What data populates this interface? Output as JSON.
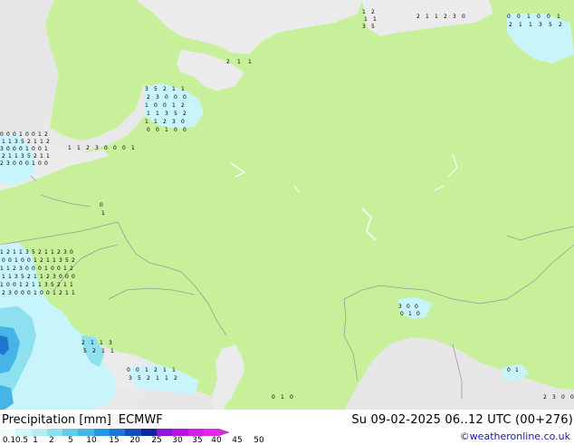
{
  "map": {
    "land_color": "#c8f09a",
    "foreign_land_color": "#e8e8e8",
    "sea_color": "#ebebeb",
    "border_color": "#9a9a9a",
    "precip_colors": [
      "#c8f4fc",
      "#8ce0f0",
      "#46b4e6",
      "#1e78d2"
    ],
    "marker_values": [
      "0",
      "0",
      "0",
      "1",
      "0",
      "0",
      "1",
      "2",
      "1",
      "1",
      "3",
      "5",
      "2",
      "1",
      "1",
      "2",
      "3"
    ]
  },
  "legend": {
    "title": "Precipitation [mm]",
    "model": "ECMWF",
    "labels": [
      "0.1",
      "0.5",
      "1",
      "2",
      "5",
      "10",
      "15",
      "20",
      "25",
      "30",
      "35",
      "40",
      "45",
      "50"
    ],
    "colors": [
      "#f0fcfc",
      "#d2f4fa",
      "#b4ecf4",
      "#8ce0f0",
      "#64cce8",
      "#46b4e6",
      "#2896dc",
      "#1e78d2",
      "#1450b4",
      "#0a2896",
      "#8c14dc",
      "#b414e6",
      "#d21ee6",
      "#e628e6",
      "#cc33cc"
    ]
  },
  "valid_time": "Su 09-02-2025 06..12 UTC (00+276)",
  "credit": "©weatheronline.co.uk"
}
